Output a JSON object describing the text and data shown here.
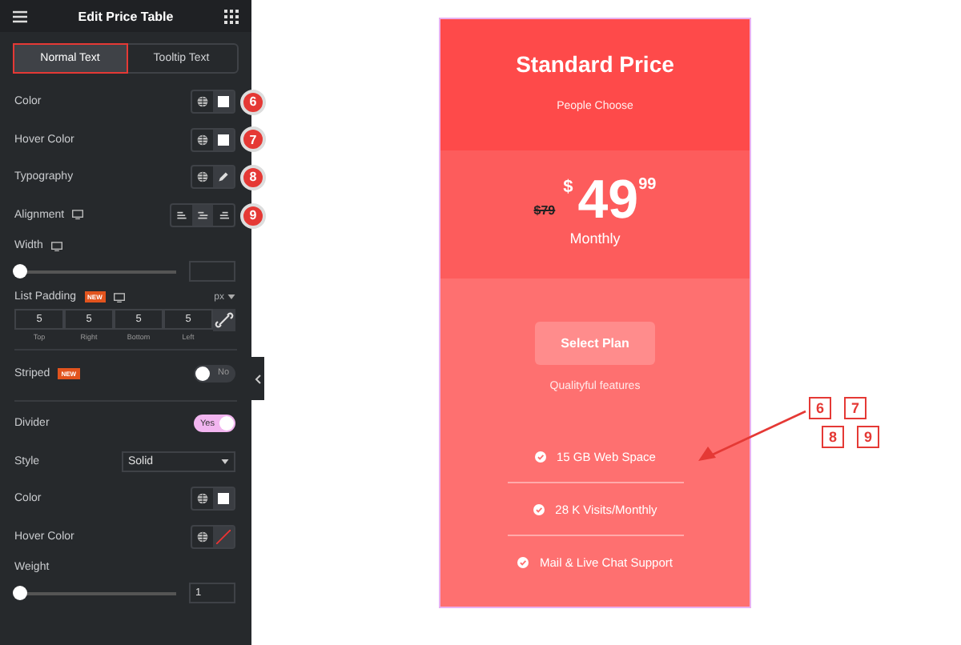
{
  "panel": {
    "title": "Edit Price Table",
    "tabs": [
      {
        "label": "Normal Text",
        "selected": true
      },
      {
        "label": "Tooltip Text",
        "selected": false
      }
    ],
    "controls": [
      {
        "kind": "color",
        "label": "Color",
        "marker": "6",
        "empty": false
      },
      {
        "kind": "color",
        "label": "Hover Color",
        "marker": "7",
        "empty": false
      },
      {
        "kind": "typography",
        "label": "Typography",
        "marker": "8"
      },
      {
        "kind": "alignment",
        "label": "Alignment",
        "responsive": true,
        "marker": "9",
        "options": [
          {
            "selected": false
          },
          {
            "selected": true
          },
          {
            "selected": false
          }
        ]
      },
      {
        "kind": "slider",
        "label": "Width",
        "responsive": true,
        "level": 0
      },
      {
        "kind": "dimensions",
        "label": "List Padding",
        "badge": "NEW",
        "responsive": true,
        "unit": "px",
        "fields": [
          {
            "value": "5",
            "label": "Top"
          },
          {
            "value": "5",
            "label": "Right"
          },
          {
            "value": "5",
            "label": "Bottom"
          },
          {
            "value": "5",
            "label": "Left"
          }
        ]
      },
      {
        "kind": "switch",
        "label": "Striped",
        "badge": "NEW",
        "on": false,
        "text": "No"
      },
      {
        "kind": "switch",
        "label": "Divider",
        "on": true,
        "text": "Yes"
      },
      {
        "kind": "select",
        "label": "Style",
        "value": "Solid"
      },
      {
        "kind": "color",
        "label": "Color",
        "empty": false
      },
      {
        "kind": "color",
        "label": "Hover Color",
        "empty": true
      },
      {
        "kind": "slider",
        "label": "Weight",
        "level": 0,
        "value": "1"
      }
    ]
  },
  "card": {
    "title": "Standard Price",
    "subtitle": "People Choose",
    "old_price": "$79",
    "currency": "$",
    "price": "49",
    "fraction": "99",
    "period": "Monthly",
    "button": "Select Plan",
    "note": "Qualityful features",
    "features": [
      "15 GB Web Space",
      "28 K Visits/Monthly",
      "Mail & Live Chat Support"
    ]
  },
  "callouts": [
    "6",
    "7",
    "8",
    "9"
  ]
}
